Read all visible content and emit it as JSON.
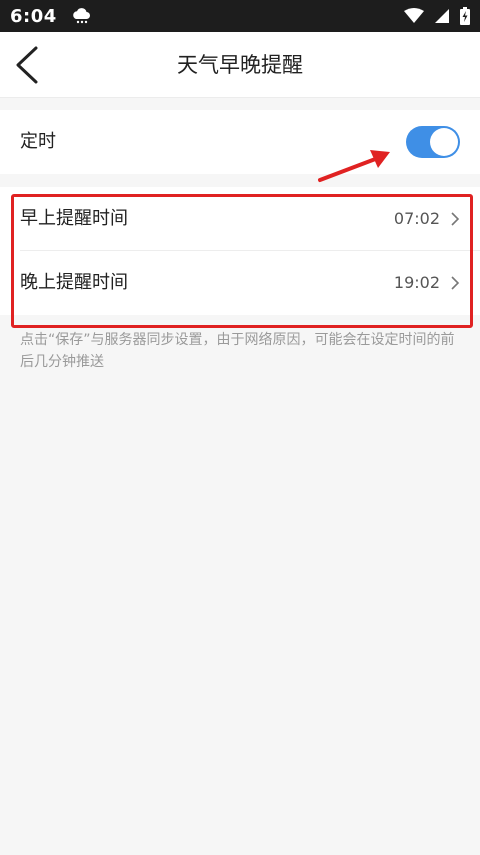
{
  "status_bar": {
    "time": "6:04",
    "notification_icon": "cloud-icon",
    "icons": [
      "wifi-icon",
      "signal-icon",
      "battery-icon"
    ]
  },
  "header": {
    "back_icon": "back-arrow-icon",
    "title": "天气早晚提醒"
  },
  "timer": {
    "label": "定时",
    "enabled": true,
    "accent_color": "#3f8fe6"
  },
  "reminders": [
    {
      "label": "早上提醒时间",
      "value": "07:02"
    },
    {
      "label": "晚上提醒时间",
      "value": "19:02"
    }
  ],
  "note": "点击“保存”与服务器同步设置，由于网络原因，可能会在设定时间的前后几分钟推送",
  "annotation": {
    "highlight_color": "#e02222"
  }
}
